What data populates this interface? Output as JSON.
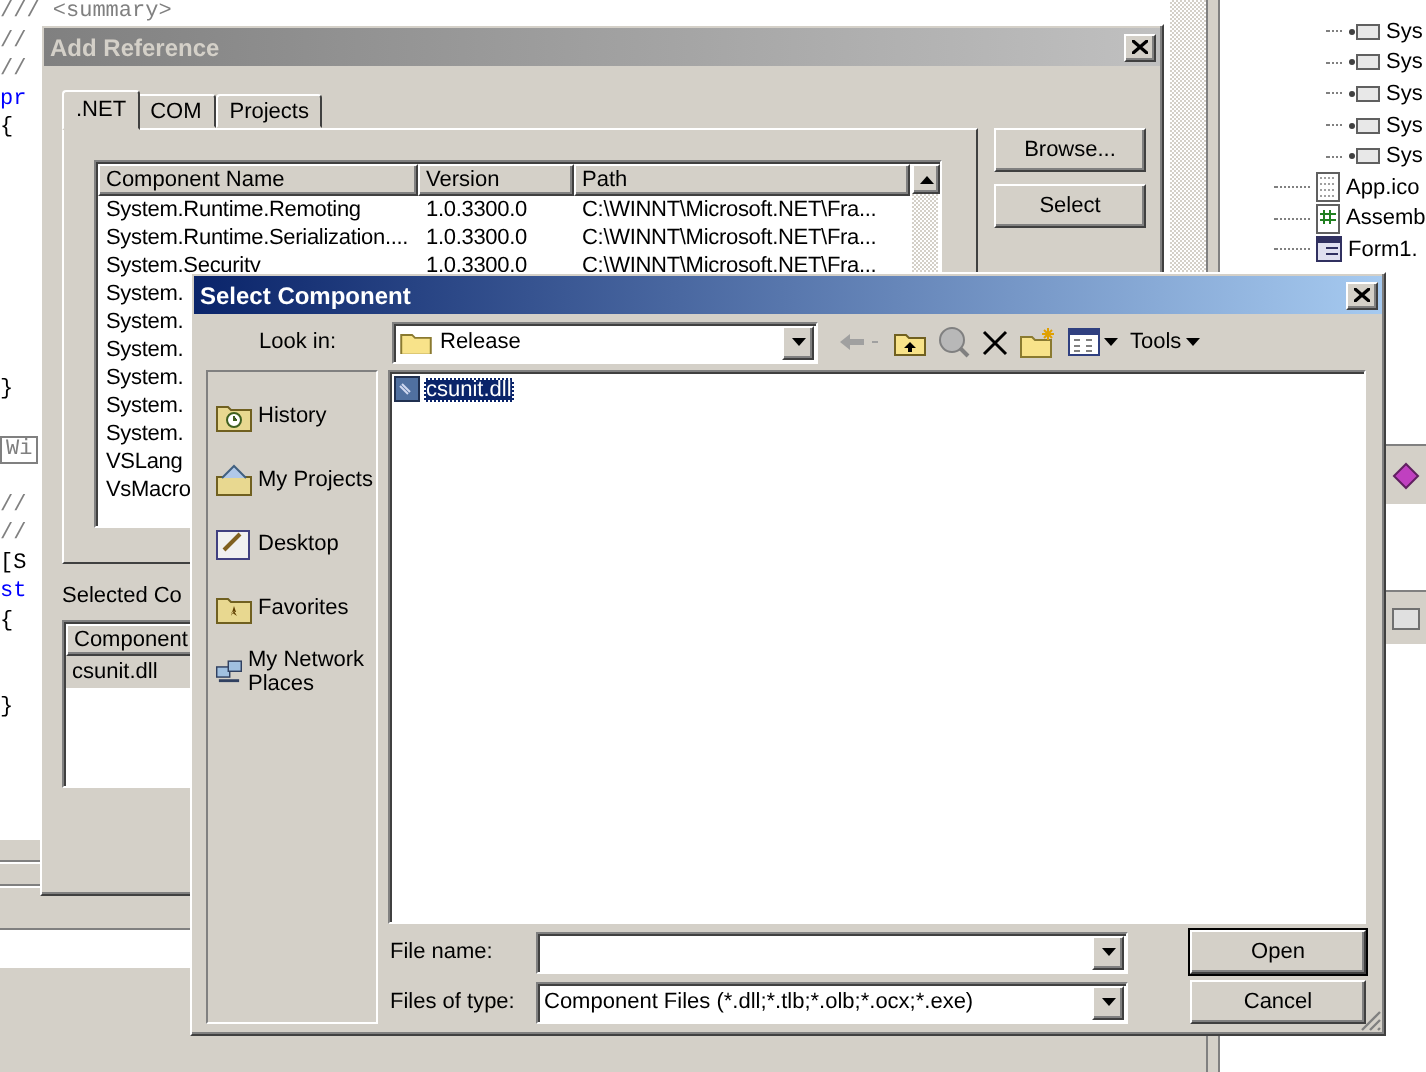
{
  "editor": {
    "lines": [
      {
        "kind": "comment",
        "text": "/// <summary>"
      },
      {
        "kind": "comment",
        "text": "//"
      },
      {
        "kind": "comment",
        "text": "//"
      },
      {
        "kind": "keyword",
        "text": "pr"
      },
      {
        "kind": "plain",
        "text": "{"
      },
      {
        "kind": "blank"
      },
      {
        "kind": "blank"
      },
      {
        "kind": "blank"
      },
      {
        "kind": "blank"
      },
      {
        "kind": "blank"
      },
      {
        "kind": "blank"
      },
      {
        "kind": "blank"
      },
      {
        "kind": "blank"
      },
      {
        "kind": "plain",
        "text": "}"
      },
      {
        "kind": "blank"
      },
      {
        "kind": "box",
        "text": "Wi"
      },
      {
        "kind": "blank"
      },
      {
        "kind": "comment",
        "text": "//"
      },
      {
        "kind": "comment",
        "text": "//"
      },
      {
        "kind": "plain",
        "text": "[S"
      },
      {
        "kind": "keyword",
        "text": "st"
      },
      {
        "kind": "plain",
        "text": "{"
      },
      {
        "kind": "blank"
      },
      {
        "kind": "blank"
      },
      {
        "kind": "plain",
        "text": "}"
      }
    ]
  },
  "solution_explorer": {
    "items": [
      {
        "kind": "reference",
        "text": "Sys"
      },
      {
        "kind": "reference",
        "text": "Sys"
      },
      {
        "kind": "reference",
        "text": "Sys"
      },
      {
        "kind": "reference",
        "text": "Sys"
      },
      {
        "kind": "reference",
        "text": "Sys"
      },
      {
        "kind": "icon-file",
        "text": "App.ico"
      },
      {
        "kind": "code-file",
        "text": "Assemb"
      },
      {
        "kind": "form-file",
        "text": "Form1."
      }
    ]
  },
  "add_reference": {
    "title": "Add Reference",
    "tabs": [
      {
        "label": ".NET",
        "selected": true
      },
      {
        "label": "COM",
        "selected": false
      },
      {
        "label": "Projects",
        "selected": false
      }
    ],
    "columns": [
      "Component Name",
      "Version",
      "Path"
    ],
    "rows": [
      {
        "name": "System.Runtime.Remoting",
        "version": "1.0.3300.0",
        "path": "C:\\WINNT\\Microsoft.NET\\Fra..."
      },
      {
        "name": "System.Runtime.Serialization....",
        "version": "1.0.3300.0",
        "path": "C:\\WINNT\\Microsoft.NET\\Fra..."
      },
      {
        "name": "System.Security",
        "version": "1.0.3300.0",
        "path": "C:\\WINNT\\Microsoft.NET\\Fra..."
      },
      {
        "name": "System."
      },
      {
        "name": "System."
      },
      {
        "name": "System."
      },
      {
        "name": "System."
      },
      {
        "name": "System."
      },
      {
        "name": "System."
      },
      {
        "name": "VSLang"
      },
      {
        "name": "VsMacro"
      }
    ],
    "buttons": [
      "Browse...",
      "Select"
    ],
    "selected_components": {
      "label": "Selected Co",
      "columns": [
        "Component"
      ],
      "rows": [
        {
          "name": "csunit.dll",
          "selected": true
        }
      ]
    }
  },
  "select_component": {
    "title": "Select Component",
    "look_in": {
      "label": "Look in:",
      "value": "Release"
    },
    "toolbar": [
      {
        "kind": "back",
        "disabled": true
      },
      {
        "kind": "up-folder",
        "disabled": false
      },
      {
        "kind": "search-web",
        "disabled": true
      },
      {
        "kind": "delete",
        "disabled": false
      },
      {
        "kind": "new-folder",
        "disabled": false
      },
      {
        "kind": "views",
        "disabled": false
      }
    ],
    "tools_menu": "Tools",
    "places": [
      {
        "kind": "history",
        "label": "History"
      },
      {
        "kind": "projects",
        "label": "My Projects"
      },
      {
        "kind": "desktop",
        "label": "Desktop"
      },
      {
        "kind": "favorites",
        "label": "Favorites"
      },
      {
        "kind": "network",
        "label": "My Network Places"
      }
    ],
    "files": [
      {
        "name": "csunit.dll",
        "selected": true
      }
    ],
    "file_name": {
      "label": "File name:"
    },
    "file_type": {
      "label": "Files of type:",
      "value": "Component Files (*.dll;*.tlb;*.olb;*.ocx;*.exe)"
    },
    "buttons": [
      {
        "label": "Open",
        "default": true
      },
      {
        "label": "Cancel",
        "default": false
      }
    ]
  }
}
